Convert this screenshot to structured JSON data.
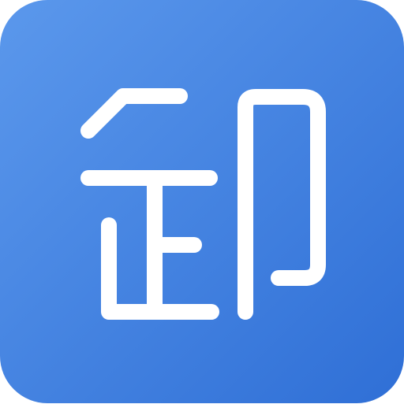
{
  "app_icon": {
    "icon_name": "uninstall-glyph-icon",
    "glyph": "卸",
    "colors": {
      "gradient_start": "#5B98EC",
      "gradient_end": "#2F6FD6",
      "glyph": "#FFFFFF"
    }
  }
}
